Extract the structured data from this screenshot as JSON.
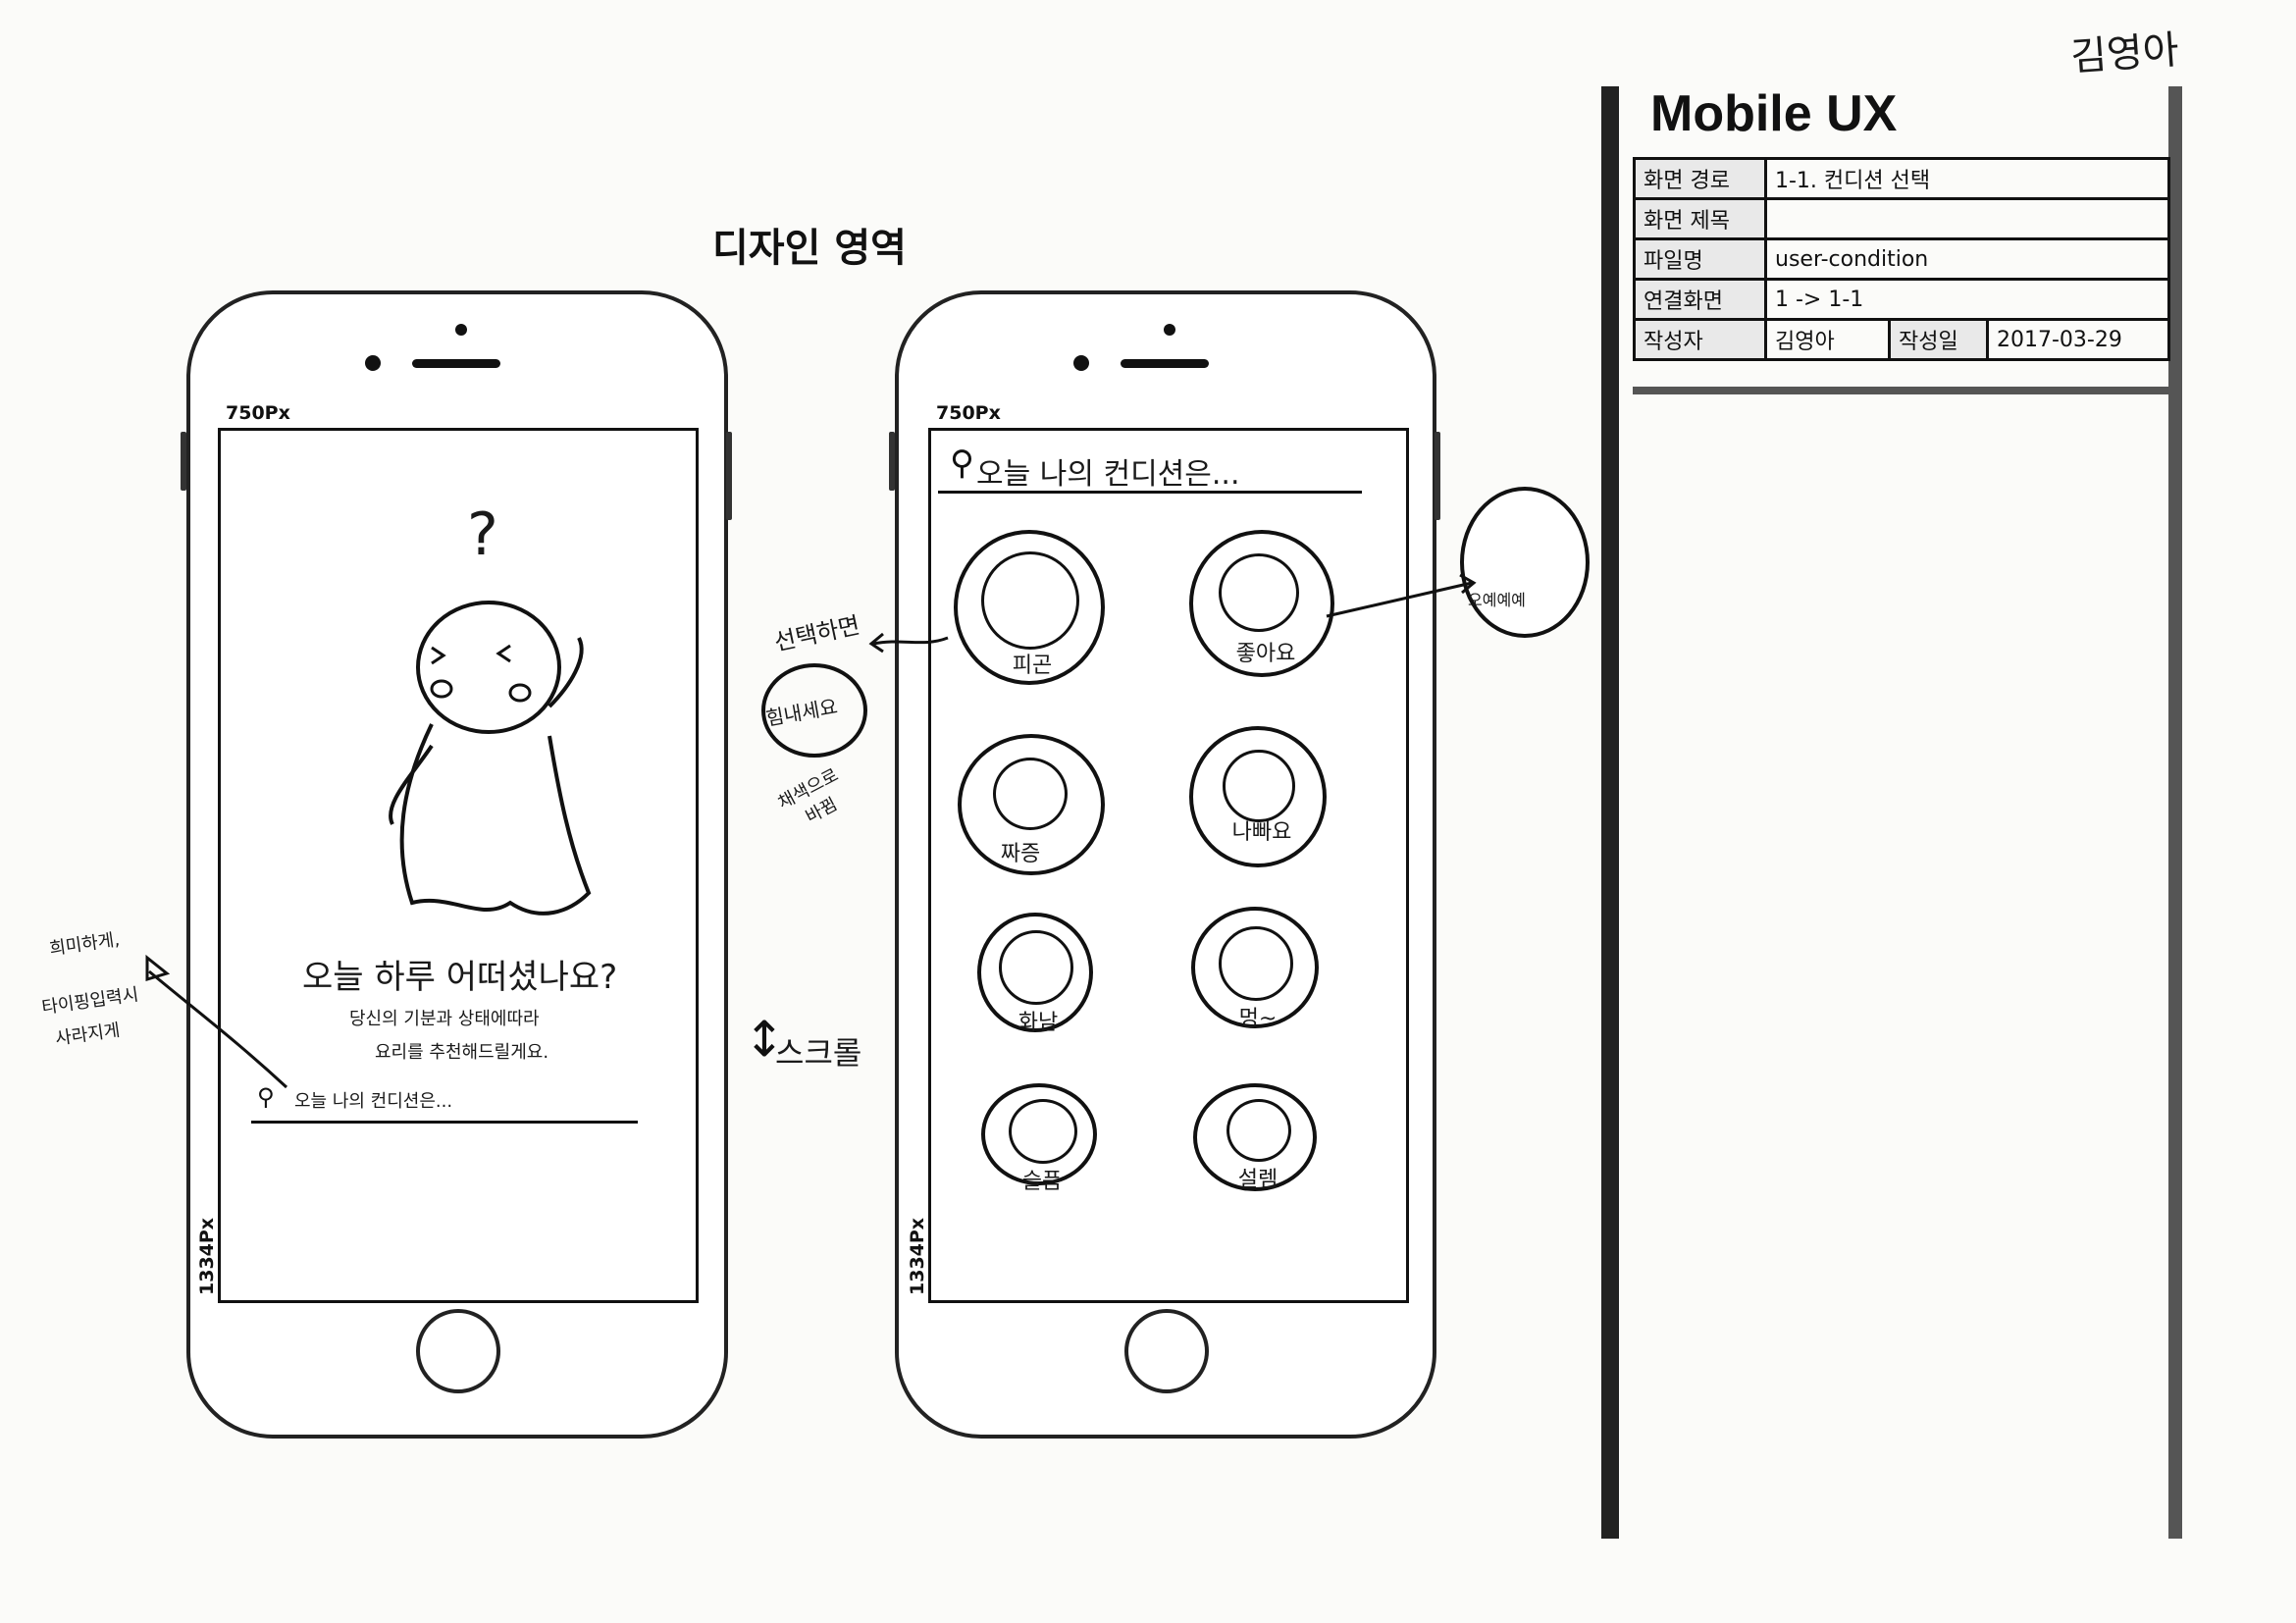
{
  "signature": "김영아",
  "design_area_title": "디자인 영역",
  "screen1": {
    "width_label": "750Px",
    "height_label": "1334Px",
    "question_mark": "?",
    "headline": "오늘 하루 어떠셨나요?",
    "sub1": "당신의 기분과 상태에따라",
    "sub2": "요리를 추천해드릴게요.",
    "search_label": "오늘 나의 컨디션은..."
  },
  "screen2": {
    "width_label": "750Px",
    "height_label": "1334Px",
    "search_label": "오늘 나의 컨디션은...",
    "conditions": [
      {
        "label": "피곤"
      },
      {
        "label": "좋아요"
      },
      {
        "label": "짜증"
      },
      {
        "label": "나빠요"
      },
      {
        "label": "화남"
      },
      {
        "label": "멍~"
      },
      {
        "label": "슬픔"
      },
      {
        "label": "설렘"
      }
    ]
  },
  "annotations": {
    "select": "선택하면",
    "cheer": "힘내세요",
    "color_line1": "채색으로",
    "color_line2": "바뀜",
    "scroll": "스크롤",
    "fade_line1": "희미하게,",
    "fade_line2": "타이핑입력시",
    "fade_line3": "사라지게",
    "popup": "오예예예"
  },
  "spec_panel": {
    "title": "Mobile UX",
    "rows": [
      {
        "key": "화면 경로",
        "value": "1-1. 컨디션 선택"
      },
      {
        "key": "화면 제목",
        "value": ""
      },
      {
        "key": "파일명",
        "value": "user-condition"
      },
      {
        "key": "연결화면",
        "value": "1 -> 1-1"
      }
    ],
    "author_key": "작성자",
    "author_value": "김영아",
    "date_key": "작성일",
    "date_value": "2017-03-29"
  }
}
